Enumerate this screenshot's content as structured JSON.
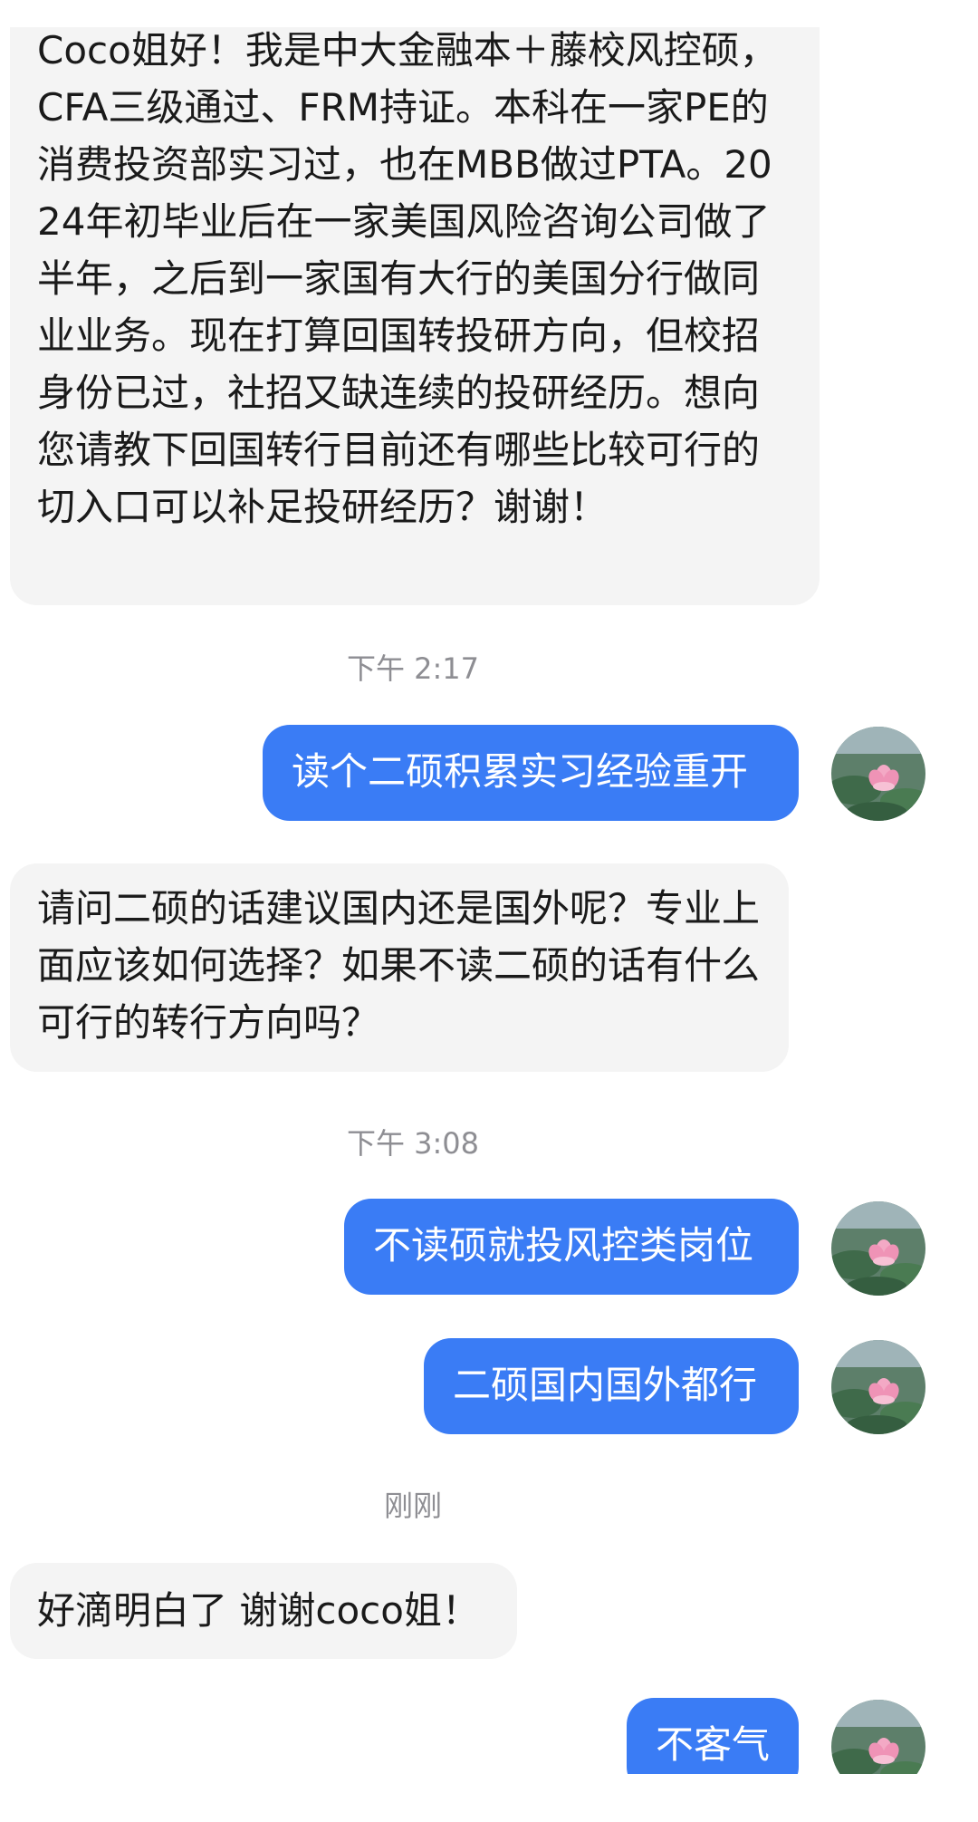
{
  "messages": {
    "m1": {
      "text": "Coco姐好！我是中大金融本＋藤校风控硕，CFA三级通过、FRM持证。本科在一家PE的消费投资部实习过，也在MBB做过PTA。2024年初毕业后在一家美国风险咨询公司做了半年，之后到一家国有大行的美国分行做同业业务。现在打算回国转投研方向，但校招身份已过，社招又缺连续的投研经历。想向您请教下回国转行目前还有哪些比较可行的切入口可以补足投研经历？谢谢！"
    },
    "t1": {
      "text": "下午 2:17"
    },
    "m2": {
      "text": "读个二硕积累实习经验重开"
    },
    "m3": {
      "text": "请问二硕的话建议国内还是国外呢？专业上面应该如何选择？如果不读二硕的话有什么可行的转行方向吗？"
    },
    "t2": {
      "text": "下午 3:08"
    },
    "m4": {
      "text": "不读硕就投风控类岗位"
    },
    "m5": {
      "text": "二硕国内国外都行"
    },
    "t3": {
      "text": "刚刚"
    },
    "m6": {
      "text": "好滴明白了 谢谢coco姐！"
    },
    "m7": {
      "text": "不客气"
    }
  },
  "colors": {
    "incoming_bubble": "#f4f4f4",
    "outgoing_bubble": "#3a7cf5",
    "timestamp": "#8e8e93"
  },
  "icons": {
    "avatar": "lotus-avatar-icon"
  }
}
